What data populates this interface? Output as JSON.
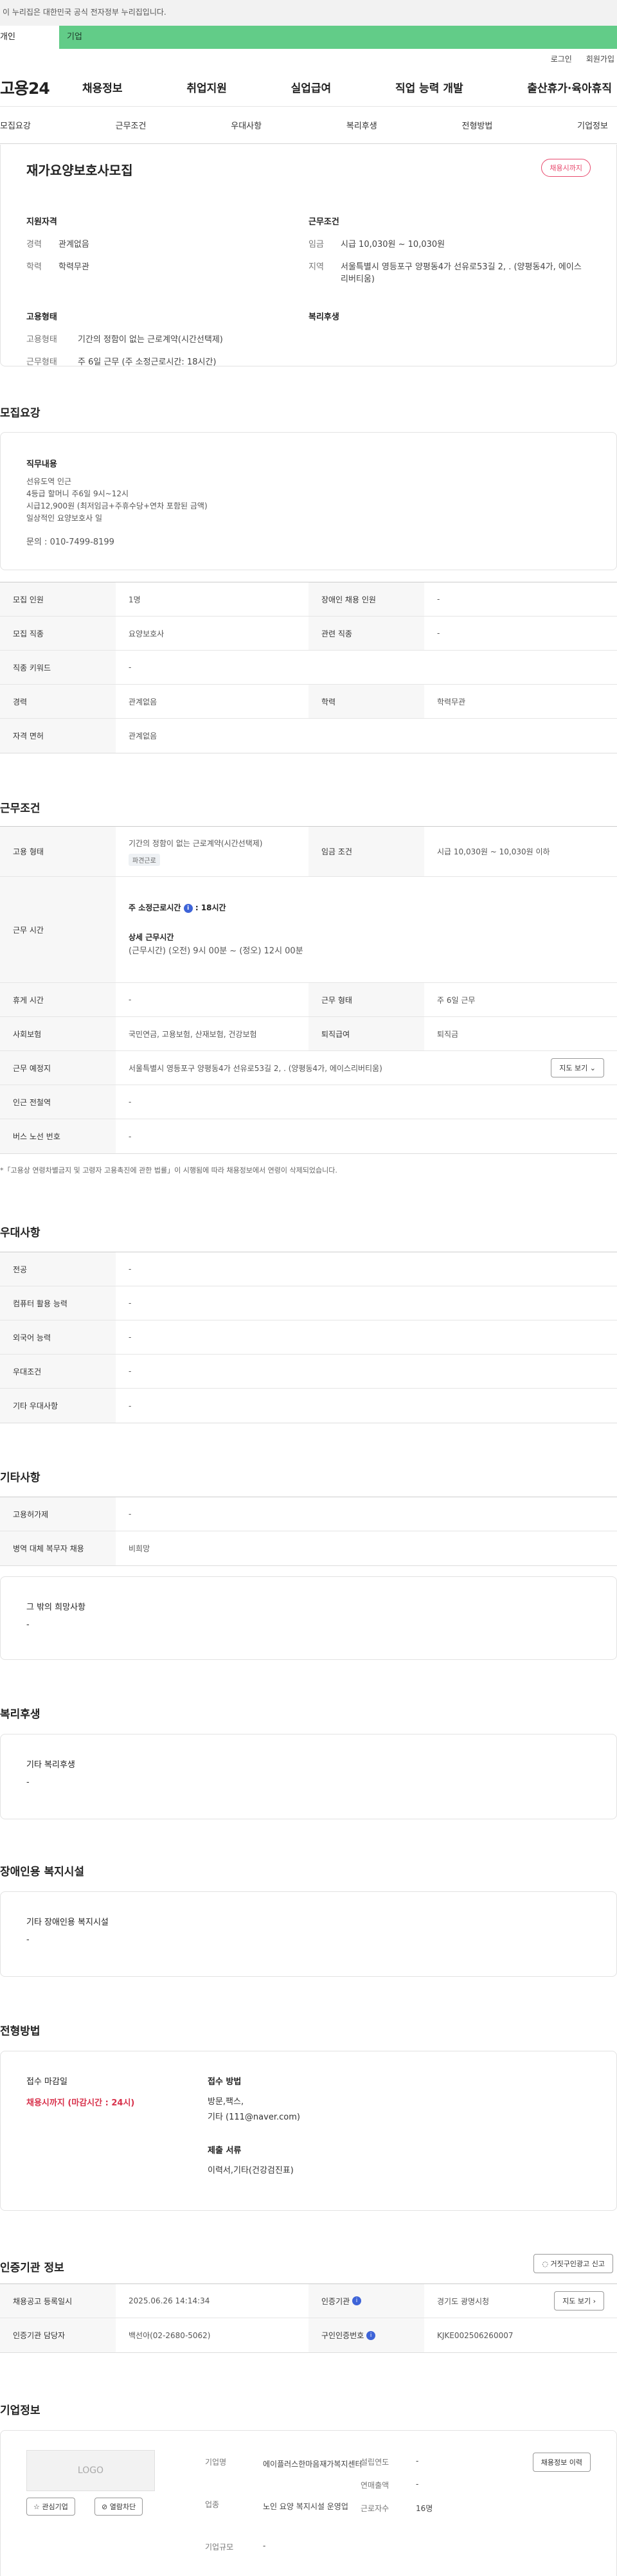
{
  "gov_banner": "이 누리집은 대한민국 공식 전자정부 누리집입니다.",
  "usertabs": {
    "individual": "개인",
    "business": "기업"
  },
  "util": {
    "login": "로그인",
    "join": "회원가입"
  },
  "logo": "고용24",
  "gnb": [
    "채용정보",
    "취업지원",
    "실업급여",
    "직업 능력 개발",
    "출산휴가·육아휴직"
  ],
  "subnav": [
    "모집요강",
    "근무조건",
    "우대사항",
    "복리후생",
    "전형방법",
    "기업정보"
  ],
  "job": {
    "title": "재가요양보호사모집",
    "badge": "채용시까지",
    "qual_title": "지원자격",
    "qual": [
      {
        "k": "경력",
        "v": "관계없음"
      },
      {
        "k": "학력",
        "v": "학력무관"
      }
    ],
    "cond_title": "근무조건",
    "cond": [
      {
        "k": "임금",
        "v": "시급 10,030원 ~ 10,030원"
      },
      {
        "k": "지역",
        "v": "서울특별시 영등포구 양평동4가 선유로53길 2, . (양평동4가, 에이스리버티움)"
      }
    ],
    "emp_title": "고용형태",
    "emp": [
      {
        "k": "고용형태",
        "v": "기간의 정함이 없는 근로계약(시간선택제)"
      },
      {
        "k": "근무형태",
        "v": "주 6일 근무 (주 소정근로시간: 18시간)"
      }
    ],
    "welfare_title": "복리후생"
  },
  "recruit": {
    "title": "모집요강",
    "duty_title": "직무내용",
    "duty_lines": [
      "선유도역 인근",
      "4등급 할머니 주6일 9시~12시",
      "시급12,900원 (최저임금+주휴수당+연차 포함된 금액)",
      "일상적인 요양보호사 일"
    ],
    "contact": "문의 : 010-7499-8199",
    "rows": [
      [
        {
          "k": "모집 인원",
          "v": "1명"
        },
        {
          "k": "장애인 채용 인원",
          "v": "-"
        }
      ],
      [
        {
          "k": "모집 직종",
          "v": "요양보호사"
        },
        {
          "k": "관련 직종",
          "v": "-"
        }
      ],
      [
        {
          "k": "직종 키워드",
          "v": "-"
        }
      ],
      [
        {
          "k": "경력",
          "v": "관계없음"
        },
        {
          "k": "학력",
          "v": "학력무관"
        }
      ],
      [
        {
          "k": "자격 면허",
          "v": "관계없음"
        }
      ]
    ]
  },
  "work": {
    "title": "근무조건",
    "emp_k": "고용 형태",
    "emp_v": "기간의 정함이 없는 근로계약(시간선택제)",
    "emp_tag": "파견근로",
    "wage_k": "임금 조건",
    "wage_v": "시급 10,030원 ~ 10,030원 이하",
    "time_k": "근무 시간",
    "time_week": "주 소정근로시간",
    "time_week_v": ": 18시간",
    "time_detail_t": "상세 근무시간",
    "time_detail_v": "(근무시간) (오전) 9시 00분 ~ (정오) 12시 00분",
    "rest_k": "휴게 시간",
    "rest_v": "-",
    "form_k": "근무 형태",
    "form_v": "주 6일 근무",
    "ins_k": "사회보험",
    "ins_v": "국민연금, 고용보험, 산재보험, 건강보험",
    "ret_k": "퇴직급여",
    "ret_v": "퇴직금",
    "loc_k": "근무 예정지",
    "loc_v": "서울특별시 영등포구 양평동4가 선유로53길 2, . (양평동4가, 에이스리버티움)",
    "map_btn": "지도 보기",
    "sub_k": "인근 전철역",
    "sub_v": "-",
    "bus_k": "버스 노선 번호",
    "bus_v": "-",
    "note": "*「고용상 연령차별금지 및 고령자 고용촉진에 관한 법률」이 시행됨에 따라 채용정보에서 연령이 삭제되었습니다."
  },
  "pref": {
    "title": "우대사항",
    "rows": [
      {
        "k": "전공",
        "v": "-"
      },
      {
        "k": "컴퓨터 활용 능력",
        "v": "-"
      },
      {
        "k": "외국어 능력",
        "v": "-"
      },
      {
        "k": "우대조건",
        "v": "-"
      },
      {
        "k": "기타 우대사항",
        "v": "-"
      }
    ]
  },
  "etc": {
    "title": "기타사항",
    "rows": [
      {
        "k": "고용허가제",
        "v": "-"
      },
      {
        "k": "병역 대체 복무자 채용",
        "v": "비희망"
      }
    ],
    "hope_t": "그 밖의 희망사항",
    "hope_v": "-"
  },
  "welfare": {
    "title": "복리후생",
    "t": "기타 복리후생",
    "v": "-"
  },
  "disab": {
    "title": "장애인용 복지시설",
    "t": "기타 장애인용 복지시설",
    "v": "-"
  },
  "screen": {
    "title": "전형방법",
    "deadline_t": "접수 마감일",
    "deadline_v": "채용시까지 (마감시간 : 24시)",
    "method_t": "접수 방법",
    "method_lines": [
      "방문,팩스,",
      "기타 (111@naver.com)"
    ],
    "docs_t": "제출 서류",
    "docs_v": "이력서,기타(건강검진표)"
  },
  "cert": {
    "title": "인증기관 정보",
    "report_btn": "거짓구인광고 신고",
    "r1": [
      {
        "k": "채용공고 등록일시",
        "v": "2025.06.26 14:14:34"
      },
      {
        "k": "인증기관",
        "v": "경기도 광명시청"
      }
    ],
    "map_btn": "지도 보기",
    "r2": [
      {
        "k": "인증기관 담당자",
        "v": "백선아(02-2680-5062)"
      },
      {
        "k": "구인인증번호",
        "v": "KJKE002506260007"
      }
    ]
  },
  "company": {
    "title": "기업정보",
    "logo": "LOGO",
    "fav": "관심기업",
    "block": "열람차단",
    "name_k": "기업명",
    "name_v": "에이플러스한마음재가복지센터",
    "found_k": "설립연도",
    "found_v": "-",
    "sales_k": "연매출액",
    "sales_v": "-",
    "ind_k": "업종",
    "ind_v": "노인 요양 복지시설 운영업",
    "emp_k": "근로자수",
    "emp_v": "16명",
    "size_k": "기업규모",
    "size_v": "-",
    "info_btn": "채용정보 이력"
  },
  "colors": {
    "accent": "#62cc88",
    "badge": "#e84a6e",
    "deadline": "#d8324c",
    "info": "#3e64d8"
  }
}
